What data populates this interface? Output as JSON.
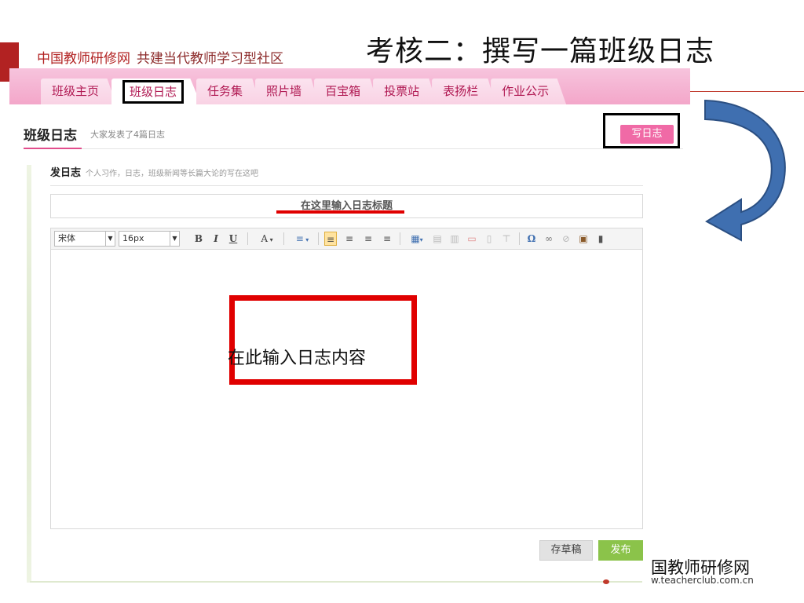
{
  "slide": {
    "title": "考核二：撰写一篇班级日志"
  },
  "site": {
    "name": "中国教师研修网",
    "slogan": "共建当代教师学习型社区"
  },
  "nav": {
    "tabs": [
      {
        "label": "班级主页",
        "active": false
      },
      {
        "label": "班级日志",
        "active": true
      },
      {
        "label": "任务集",
        "active": false
      },
      {
        "label": "照片墙",
        "active": false
      },
      {
        "label": "百宝箱",
        "active": false
      },
      {
        "label": "投票站",
        "active": false
      },
      {
        "label": "表扬栏",
        "active": false
      },
      {
        "label": "作业公示",
        "active": false
      }
    ]
  },
  "section": {
    "title": "班级日志",
    "subtitle": "大家发表了4篇日志",
    "write_button": "写日志"
  },
  "compose": {
    "heading": "发日志",
    "hint": "个人习作，日志，班级新闻等长篇大论的写在这吧",
    "title_placeholder": "在这里输入日志标题"
  },
  "toolbar": {
    "font_family": "宋体",
    "font_size": "16px",
    "bold": "B",
    "italic": "I",
    "underline": "U",
    "font_color": "A",
    "list": "≡",
    "special_char": "Ω"
  },
  "editor": {
    "content_placeholder": "在此输入日志内容"
  },
  "actions": {
    "save_draft": "存草稿",
    "publish": "发布"
  },
  "watermark": {
    "name": "国教师研修网",
    "url": "w.teacherclub.com.cn"
  },
  "colors": {
    "brand_red": "#b22222",
    "nav_pink": "#f3a6c9",
    "tab_text": "#b01852",
    "write_button": "#f06aa6",
    "publish_button": "#8bc34a",
    "highlight_red": "#e00000",
    "arrow_blue": "#3f6fb0"
  }
}
